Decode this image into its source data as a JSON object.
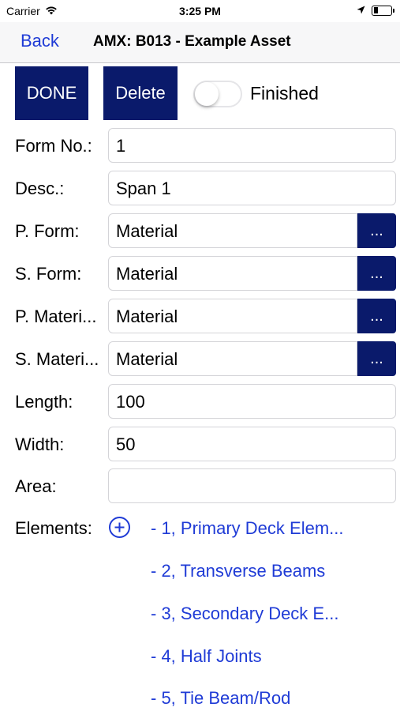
{
  "status_bar": {
    "carrier": "Carrier",
    "time": "3:25 PM",
    "battery_level": 0.25
  },
  "nav": {
    "back_label": "Back",
    "title": "AMX: B013 - Example Asset"
  },
  "toolbar": {
    "done_label": "DONE",
    "delete_label": "Delete",
    "finished_label": "Finished",
    "finished_on": false
  },
  "form": {
    "form_no": {
      "label": "Form No.:",
      "value": "1"
    },
    "desc": {
      "label": "Desc.:",
      "value": "Span 1"
    },
    "p_form": {
      "label": "P. Form:",
      "value": "Material",
      "button": "..."
    },
    "s_form": {
      "label": "S. Form:",
      "value": "Material",
      "button": "..."
    },
    "p_material": {
      "label": "P. Materi...",
      "value": "Material",
      "button": "..."
    },
    "s_material": {
      "label": "S. Materi...",
      "value": "Material",
      "button": "..."
    },
    "length": {
      "label": "Length:",
      "value": "100"
    },
    "width": {
      "label": "Width:",
      "value": "50"
    },
    "area": {
      "label": "Area:",
      "value": ""
    }
  },
  "elements": {
    "label": "Elements:",
    "items": [
      "- 1, Primary Deck Elem...",
      "- 2, Transverse Beams",
      "- 3, Secondary Deck E...",
      "- 4, Half Joints",
      "- 5, Tie Beam/Rod"
    ]
  },
  "colors": {
    "accent_link": "#1f3bd6",
    "button_navy": "#0a1a6b"
  },
  "icons": [
    "wifi-icon",
    "location-arrow-icon",
    "battery-icon",
    "add-circle-icon"
  ]
}
